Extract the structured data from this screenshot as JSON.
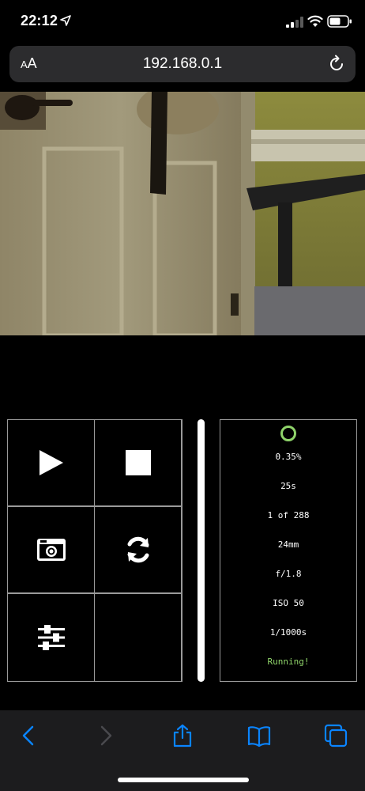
{
  "status_bar": {
    "time": "22:12",
    "icons": [
      "location-arrow-icon",
      "cellular-signal-icon",
      "wifi-icon",
      "battery-icon"
    ]
  },
  "browser": {
    "text_size_button": "AA",
    "url": "192.168.0.1",
    "reload_icon": "reload-icon"
  },
  "camera": {
    "preview_icon": "live-camera-preview"
  },
  "controls": {
    "play_icon": "play-icon",
    "stop_icon": "stop-icon",
    "capture_icon": "camera-icon",
    "refresh_icon": "refresh-icon",
    "settings_icon": "sliders-icon"
  },
  "status": {
    "indicator_color": "#8fd36a",
    "progress": "0.35%",
    "interval": "25s",
    "frame_count": "1 of 288",
    "focal_length": "24mm",
    "aperture": "f/1.8",
    "iso": "ISO 50",
    "shutter": "1/1000s",
    "state": "Running!"
  },
  "toolbar": {
    "icons": [
      "back-icon",
      "forward-icon",
      "share-icon",
      "bookmarks-icon",
      "tabs-icon"
    ],
    "accent_color": "#0a84ff"
  }
}
